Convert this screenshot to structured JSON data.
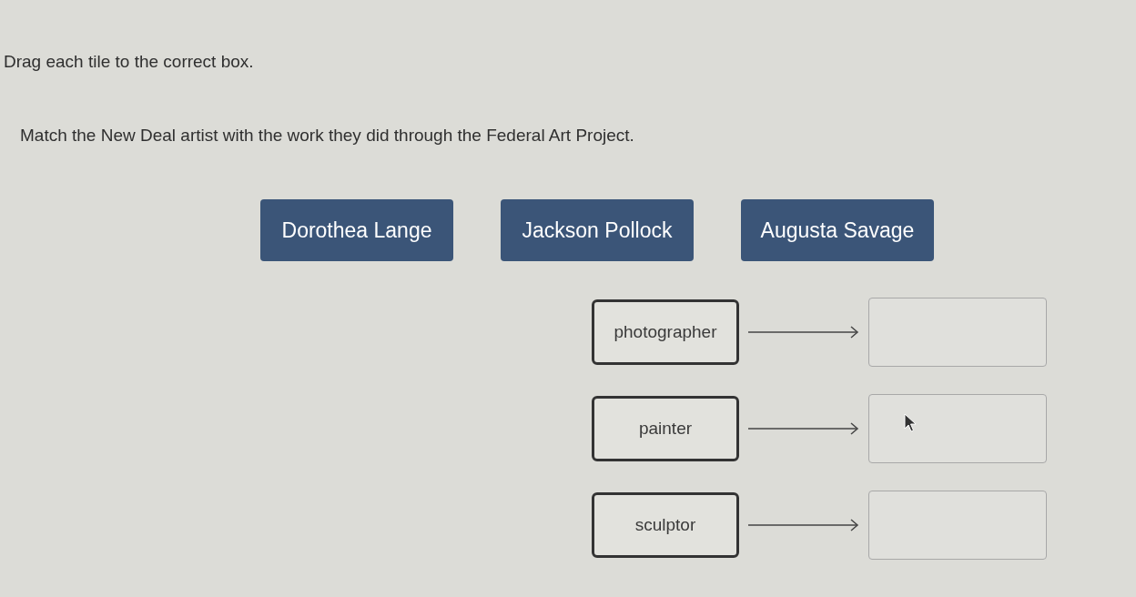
{
  "instructions": [
    "Drag each tile to the correct box.",
    "Match the New Deal artist with the work they did through the Federal Art Project."
  ],
  "tiles": [
    {
      "label": "Dorothea Lange"
    },
    {
      "label": "Jackson Pollock"
    },
    {
      "label": "Augusta Savage"
    }
  ],
  "pairs": [
    {
      "label": "photographer"
    },
    {
      "label": "painter"
    },
    {
      "label": "sculptor"
    }
  ]
}
